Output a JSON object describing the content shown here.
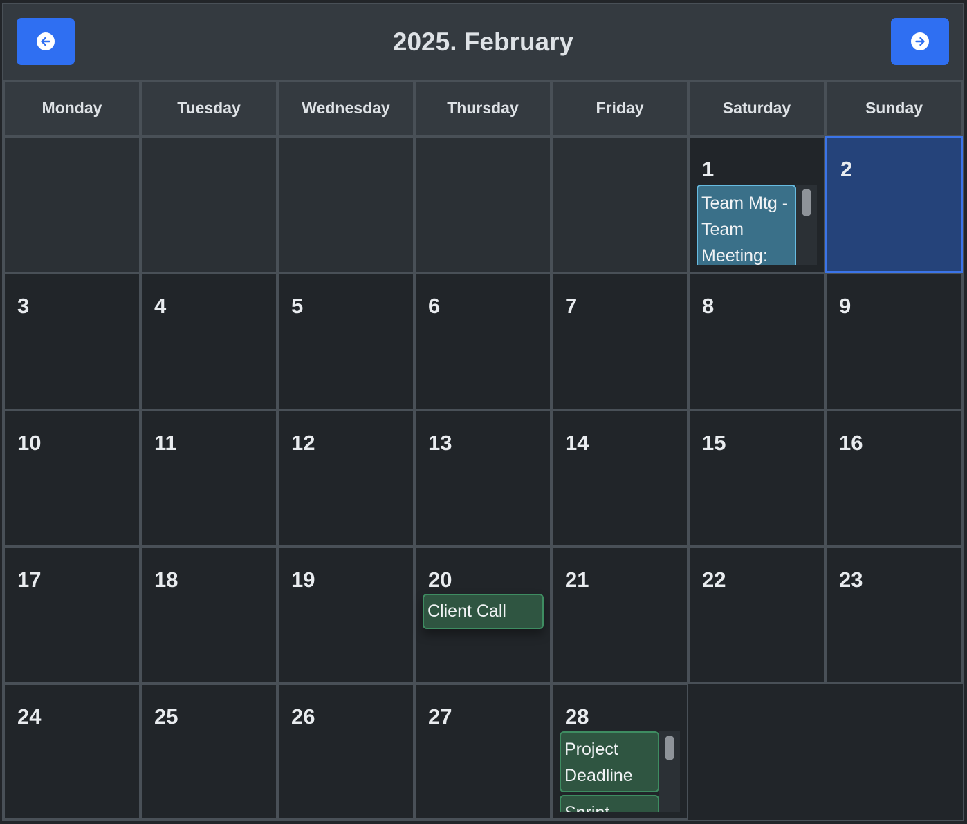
{
  "header": {
    "title": "2025. February",
    "prev_icon": "arrow-left-circle-icon",
    "next_icon": "arrow-right-circle-icon",
    "accent_color": "#2f6ff2"
  },
  "weekdays": [
    "Monday",
    "Tuesday",
    "Wednesday",
    "Thursday",
    "Friday",
    "Saturday",
    "Sunday"
  ],
  "days": {
    "d1": "1",
    "d2": "2",
    "d3": "3",
    "d4": "4",
    "d5": "5",
    "d6": "6",
    "d7": "7",
    "d8": "8",
    "d9": "9",
    "d10": "10",
    "d11": "11",
    "d12": "12",
    "d13": "13",
    "d14": "14",
    "d15": "15",
    "d16": "16",
    "d17": "17",
    "d18": "18",
    "d19": "19",
    "d20": "20",
    "d21": "21",
    "d22": "22",
    "d23": "23",
    "d24": "24",
    "d25": "25",
    "d26": "26",
    "d27": "27",
    "d28": "28"
  },
  "selected_day": "2",
  "events": {
    "feb1": [
      "Team Mtg - Team Meeting:"
    ],
    "feb20": [
      "Client Call"
    ],
    "feb28": [
      "Project Deadline",
      "Sprint"
    ]
  }
}
